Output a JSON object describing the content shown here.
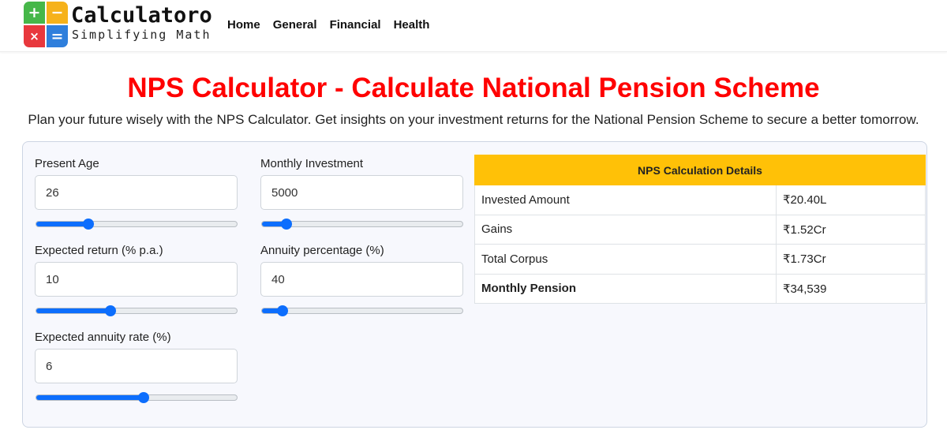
{
  "brand": {
    "name": "Calculatoro",
    "tagline": "Simplifying Math",
    "logo_symbols": [
      "+",
      "−",
      "×",
      "="
    ],
    "logo_colors": [
      "#46b749",
      "#f6b21b",
      "#e8383d",
      "#2f7fdc"
    ]
  },
  "nav": {
    "items": [
      "Home",
      "General",
      "Financial",
      "Health"
    ]
  },
  "page": {
    "title": "NPS Calculator - Calculate National Pension Scheme",
    "subtitle": "Plan your future wisely with the NPS Calculator. Get insights on your investment returns for the National Pension Scheme to secure a better tomorrow.",
    "title_color": "#ff0000"
  },
  "form": {
    "present_age": {
      "label": "Present Age",
      "value": "26",
      "slider_fraction": 0.24
    },
    "monthly_investment": {
      "label": "Monthly Investment",
      "value": "5000",
      "slider_fraction": 0.09
    },
    "expected_return": {
      "label": "Expected return (% p.a.)",
      "value": "10",
      "slider_fraction": 0.36
    },
    "annuity_percentage": {
      "label": "Annuity percentage (%)",
      "value": "40",
      "slider_fraction": 0.07
    },
    "expected_annuity_rate": {
      "label": "Expected annuity rate (%)",
      "value": "6",
      "slider_fraction": 0.54
    }
  },
  "results": {
    "heading": "NPS Calculation Details",
    "rows": [
      {
        "label": "Invested Amount",
        "value": "₹20.40L"
      },
      {
        "label": "Gains",
        "value": "₹1.52Cr"
      },
      {
        "label": "Total Corpus",
        "value": "₹1.73Cr"
      },
      {
        "label": "Monthly Pension",
        "value": "₹34,539"
      }
    ]
  },
  "colors": {
    "accent": "#0d6efd",
    "table_header": "#ffc107"
  }
}
